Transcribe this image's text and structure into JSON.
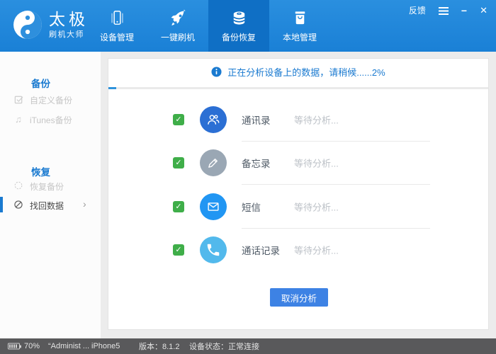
{
  "colors": {
    "header_blue": "#1e86d9",
    "active_tab_blue": "#0f6fc5",
    "accent_blue": "#1a7ad0",
    "checkbox_green": "#3fae49",
    "cancel_button_blue": "#3d82e4",
    "statusbar_gray": "#59595b"
  },
  "header": {
    "logo": {
      "title": "太极",
      "subtitle": "刷机大师"
    },
    "tabs": [
      {
        "label": "设备管理",
        "icon": "device-icon",
        "active": false
      },
      {
        "label": "一键刷机",
        "icon": "rocket-icon",
        "active": false
      },
      {
        "label": "备份恢复",
        "icon": "database-icon",
        "active": true
      },
      {
        "label": "本地管理",
        "icon": "bag-icon",
        "active": false
      }
    ],
    "feedback_label": "反馈"
  },
  "sidebar": {
    "backup_section": {
      "title": "备份",
      "items": [
        {
          "label": "自定义备份",
          "icon": "checkbox-icon"
        },
        {
          "label": "iTunes备份",
          "icon": "music-note-icon",
          "glyph": "♫"
        }
      ]
    },
    "restore_section": {
      "title": "恢复",
      "items": [
        {
          "label": "恢复备份",
          "icon": "dashed-circle-icon"
        },
        {
          "label": "找回数据",
          "icon": "recover-data-icon",
          "chevron": "›",
          "selected": true
        }
      ]
    }
  },
  "main": {
    "status_message": "正在分析设备上的数据，请稍候......2%",
    "progress_width": "2%",
    "items": [
      {
        "label": "通讯录",
        "status": "等待分析...",
        "check": "✓",
        "icon": "contacts-icon",
        "color": "#2b6fd4"
      },
      {
        "label": "备忘录",
        "status": "等待分析...",
        "check": "✓",
        "icon": "notes-icon",
        "color": "#9aa7b4"
      },
      {
        "label": "短信",
        "status": "等待分析...",
        "check": "✓",
        "icon": "sms-icon",
        "color": "#2196f3"
      },
      {
        "label": "通话记录",
        "status": "等待分析...",
        "check": "✓",
        "icon": "call-log-icon",
        "color": "#52b9ec"
      }
    ],
    "cancel_button": "取消分析"
  },
  "statusbar": {
    "battery_percent": "70%",
    "device_name": "“Administ ...",
    "device_model": "iPhone5",
    "version": "版本：8.1.2",
    "device_state": "设备状态：正常连接"
  }
}
